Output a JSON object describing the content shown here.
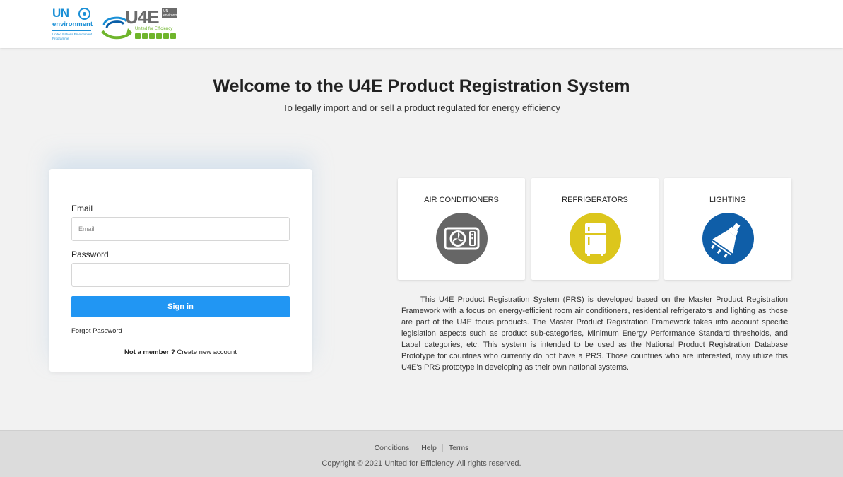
{
  "header": {
    "unep_logo": {
      "un": "UN",
      "environment": "environment",
      "subtitle": "United Nations Environment Programme"
    },
    "u4e_logo": {
      "text": "U4E",
      "un_box": "UN environment programme",
      "tagline": "United for Efficiency"
    }
  },
  "page": {
    "title": "Welcome to the U4E Product Registration System",
    "subtitle": "To legally import and or sell a product regulated for energy efficiency"
  },
  "login": {
    "email_label": "Email",
    "email_placeholder": "Email",
    "email_value": "",
    "password_label": "Password",
    "password_value": "",
    "signin_label": "Sign in",
    "forgot_label": "Forgot Password",
    "not_member_label": "Not a member ?",
    "create_account_label": "Create new account"
  },
  "categories": [
    {
      "label": "AIR CONDITIONERS",
      "icon": "air-conditioner-icon",
      "color": "#666666"
    },
    {
      "label": "REFRIGERATORS",
      "icon": "refrigerator-icon",
      "color": "#dcc61c"
    },
    {
      "label": "LIGHTING",
      "icon": "lighting-icon",
      "color": "#0f5ea8"
    }
  ],
  "description": "This U4E Product Registration System (PRS) is developed based on the Master Product Registration Framework with a focus on energy-efficient room air conditioners, residential refrigerators and lighting as those are part of the U4E focus products. The Master Product Registration Framework takes into account specific legislation aspects such as product sub-categories, Minimum Energy Performance Standard thresholds, and Label categories, etc. This system is intended to be used as the National Product Registration Database Prototype for countries who currently do not have a PRS. Those countries who are interested, may utilize this U4E's PRS prototype in developing as their own national systems.",
  "footer": {
    "links": [
      "Conditions",
      "Help",
      "Terms"
    ],
    "copyright": "Copyright © 2021 United for Efficiency. All rights reserved."
  },
  "colors": {
    "primary_button": "#2196f3",
    "unep_blue": "#1a8fd6",
    "u4e_green": "#6fb52c"
  }
}
